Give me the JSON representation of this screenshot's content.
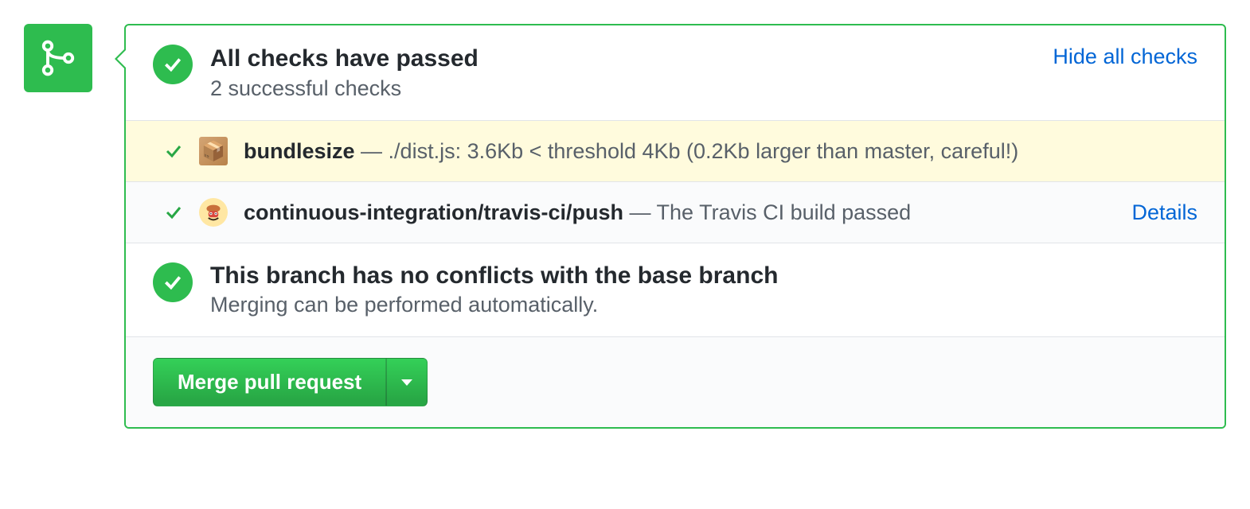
{
  "header": {
    "title": "All checks have passed",
    "subtitle": "2 successful checks",
    "hide_label": "Hide all checks"
  },
  "checks": [
    {
      "icon": "package-icon",
      "name": "bundlesize",
      "separator": " — ",
      "description": "./dist.js: 3.6Kb < threshold 4Kb (0.2Kb larger than master, careful!)",
      "highlight": true,
      "details_label": ""
    },
    {
      "icon": "travis-icon",
      "name": "continuous-integration/travis-ci/push",
      "separator": " — ",
      "description": "The Travis CI build passed",
      "highlight": false,
      "details_label": "Details"
    }
  ],
  "merge_status": {
    "title": "This branch has no conflicts with the base branch",
    "subtitle": "Merging can be performed automatically."
  },
  "actions": {
    "merge_label": "Merge pull request"
  }
}
